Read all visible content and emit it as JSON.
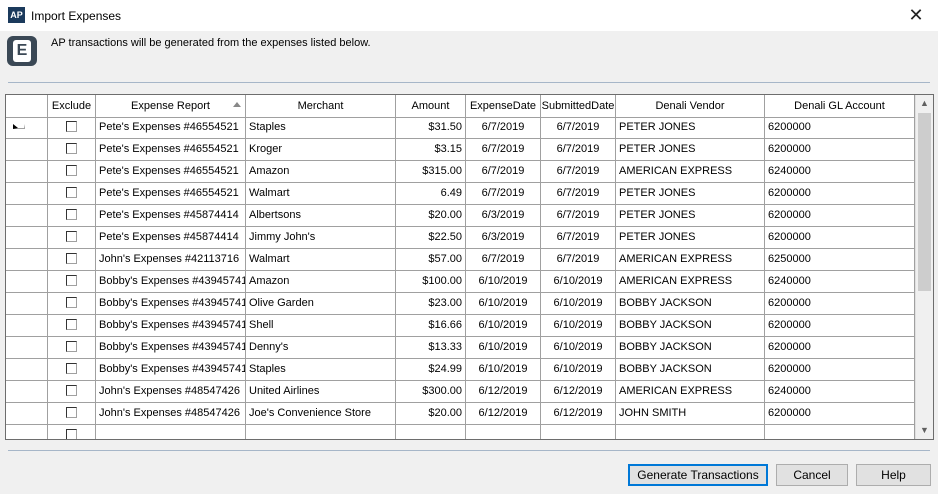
{
  "window": {
    "title": "Import Expenses",
    "badge": "AP",
    "close_glyph": "✕"
  },
  "header": {
    "logo_letter": "E",
    "message": "AP transactions will be generated from the expenses listed below."
  },
  "columns": [
    "Exclude",
    "Expense Report",
    "Merchant",
    "Amount",
    "ExpenseDate",
    "SubmittedDate",
    "Denali Vendor",
    "Denali GL Account"
  ],
  "rows": [
    {
      "report": "Pete's Expenses #46554521",
      "merchant": "Staples",
      "amount": "$31.50",
      "expense_date": "6/7/2019",
      "submitted_date": "6/7/2019",
      "vendor": "PETER JONES",
      "gl": "6200000"
    },
    {
      "report": "Pete's Expenses #46554521",
      "merchant": "Kroger",
      "amount": "$3.15",
      "expense_date": "6/7/2019",
      "submitted_date": "6/7/2019",
      "vendor": "PETER JONES",
      "gl": "6200000"
    },
    {
      "report": "Pete's Expenses #46554521",
      "merchant": "Amazon",
      "amount": "$315.00",
      "expense_date": "6/7/2019",
      "submitted_date": "6/7/2019",
      "vendor": "AMERICAN EXPRESS",
      "gl": "6240000"
    },
    {
      "report": "Pete's Expenses #46554521",
      "merchant": "Walmart",
      "amount": "6.49",
      "expense_date": "6/7/2019",
      "submitted_date": "6/7/2019",
      "vendor": "PETER JONES",
      "gl": "6200000"
    },
    {
      "report": "Pete's Expenses #45874414",
      "merchant": "Albertsons",
      "amount": "$20.00",
      "expense_date": "6/3/2019",
      "submitted_date": "6/7/2019",
      "vendor": "PETER JONES",
      "gl": "6200000"
    },
    {
      "report": "Pete's Expenses #45874414",
      "merchant": "Jimmy John's",
      "amount": "$22.50",
      "expense_date": "6/3/2019",
      "submitted_date": "6/7/2019",
      "vendor": "PETER JONES",
      "gl": "6200000"
    },
    {
      "report": "John's Expenses #42113716",
      "merchant": "Walmart",
      "amount": "$57.00",
      "expense_date": "6/7/2019",
      "submitted_date": "6/7/2019",
      "vendor": "AMERICAN EXPRESS",
      "gl": "6250000"
    },
    {
      "report": "Bobby's Expenses #43945741",
      "merchant": "Amazon",
      "amount": "$100.00",
      "expense_date": "6/10/2019",
      "submitted_date": "6/10/2019",
      "vendor": "AMERICAN EXPRESS",
      "gl": "6240000"
    },
    {
      "report": "Bobby's Expenses #43945741",
      "merchant": "Olive Garden",
      "amount": "$23.00",
      "expense_date": "6/10/2019",
      "submitted_date": "6/10/2019",
      "vendor": "BOBBY JACKSON",
      "gl": "6200000"
    },
    {
      "report": "Bobby's Expenses #43945741",
      "merchant": "Shell",
      "amount": "$16.66",
      "expense_date": "6/10/2019",
      "submitted_date": "6/10/2019",
      "vendor": "BOBBY JACKSON",
      "gl": "6200000"
    },
    {
      "report": "Bobby's Expenses #43945741",
      "merchant": "Denny's",
      "amount": "$13.33",
      "expense_date": "6/10/2019",
      "submitted_date": "6/10/2019",
      "vendor": "BOBBY JACKSON",
      "gl": "6200000"
    },
    {
      "report": "Bobby's Expenses #43945741",
      "merchant": "Staples",
      "amount": "$24.99",
      "expense_date": "6/10/2019",
      "submitted_date": "6/10/2019",
      "vendor": "BOBBY JACKSON",
      "gl": "6200000"
    },
    {
      "report": "John's Expenses #48547426",
      "merchant": "United Airlines",
      "amount": "$300.00",
      "expense_date": "6/12/2019",
      "submitted_date": "6/12/2019",
      "vendor": "AMERICAN EXPRESS",
      "gl": "6240000"
    },
    {
      "report": "John's Expenses #48547426",
      "merchant": "Joe's Convenience Store",
      "amount": "$20.00",
      "expense_date": "6/12/2019",
      "submitted_date": "6/12/2019",
      "vendor": "JOHN SMITH",
      "gl": "6200000"
    }
  ],
  "buttons": {
    "generate": "Generate Transactions",
    "cancel": "Cancel",
    "help": "Help"
  },
  "colors": {
    "accent": "#0078d7",
    "logo": "#3a4855",
    "separator": "#a6b6c8"
  }
}
